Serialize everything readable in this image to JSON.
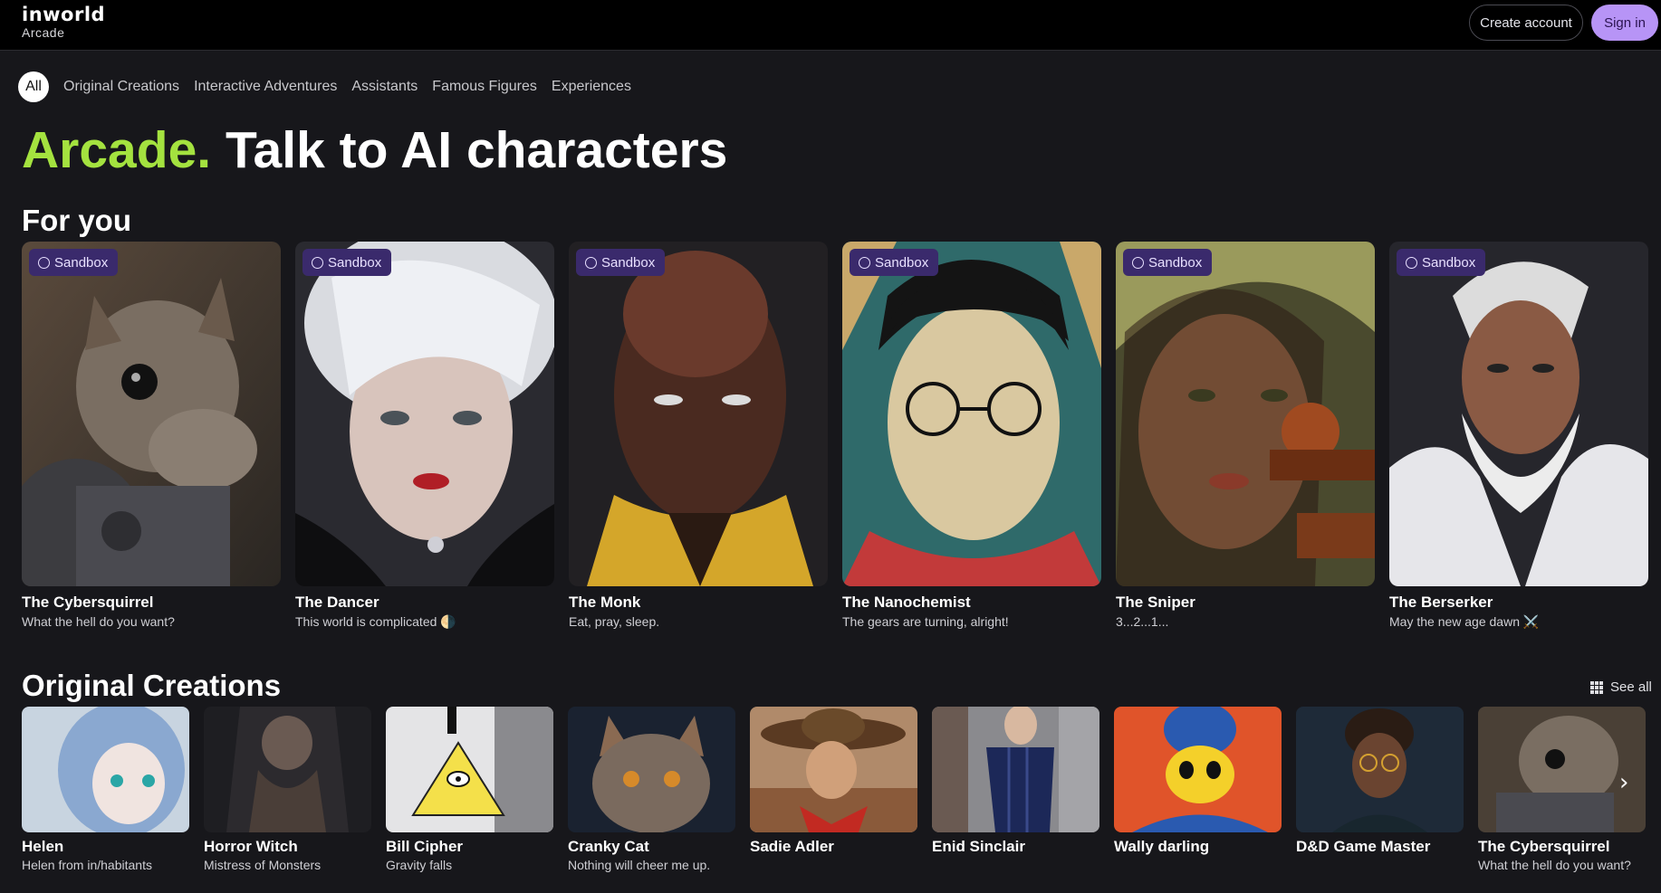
{
  "header": {
    "logo_word": "inworld",
    "logo_sub": "Arcade",
    "create_account": "Create account",
    "sign_in": "Sign in"
  },
  "categories": [
    {
      "label": "All",
      "active": true
    },
    {
      "label": "Original Creations"
    },
    {
      "label": "Interactive Adventures"
    },
    {
      "label": "Assistants"
    },
    {
      "label": "Famous Figures"
    },
    {
      "label": "Experiences"
    }
  ],
  "hero": {
    "brand": "Arcade.",
    "rest": "Talk to AI characters"
  },
  "for_you": {
    "title": "For you",
    "badge": "Sandbox",
    "cards": [
      {
        "name": "The Cybersquirrel",
        "tagline": "What the hell do you want?",
        "icon": "squirrel-portrait"
      },
      {
        "name": "The Dancer",
        "tagline": "This world is complicated 🌗",
        "icon": "woman-portrait"
      },
      {
        "name": "The Monk",
        "tagline": "Eat, pray, sleep.",
        "icon": "monk-portrait"
      },
      {
        "name": "The Nanochemist",
        "tagline": "The gears are turning, alright!",
        "icon": "glasses-man-portrait"
      },
      {
        "name": "The Sniper",
        "tagline": "3...2...1...",
        "icon": "sniper-portrait"
      },
      {
        "name": "The Berserker",
        "tagline": "May the new age dawn ⚔️",
        "icon": "viking-portrait"
      }
    ]
  },
  "original_creations": {
    "title": "Original Creations",
    "see_all": "See all",
    "cards": [
      {
        "name": "Helen",
        "tagline": "Helen from in/habitants"
      },
      {
        "name": "Horror Witch",
        "tagline": "Mistress of Monsters"
      },
      {
        "name": "Bill Cipher",
        "tagline": "Gravity falls"
      },
      {
        "name": "Cranky Cat",
        "tagline": "Nothing will cheer me up."
      },
      {
        "name": "Sadie Adler",
        "tagline": ""
      },
      {
        "name": "Enid Sinclair",
        "tagline": ""
      },
      {
        "name": "Wally darling",
        "tagline": ""
      },
      {
        "name": "D&D Game Master",
        "tagline": ""
      },
      {
        "name": "The Cybersquirrel",
        "tagline": "What the hell do you want?"
      }
    ]
  },
  "colors": {
    "accent_green": "#a4e23f",
    "accent_purple": "#b794f6",
    "badge_bg": "#3a2a6c"
  }
}
